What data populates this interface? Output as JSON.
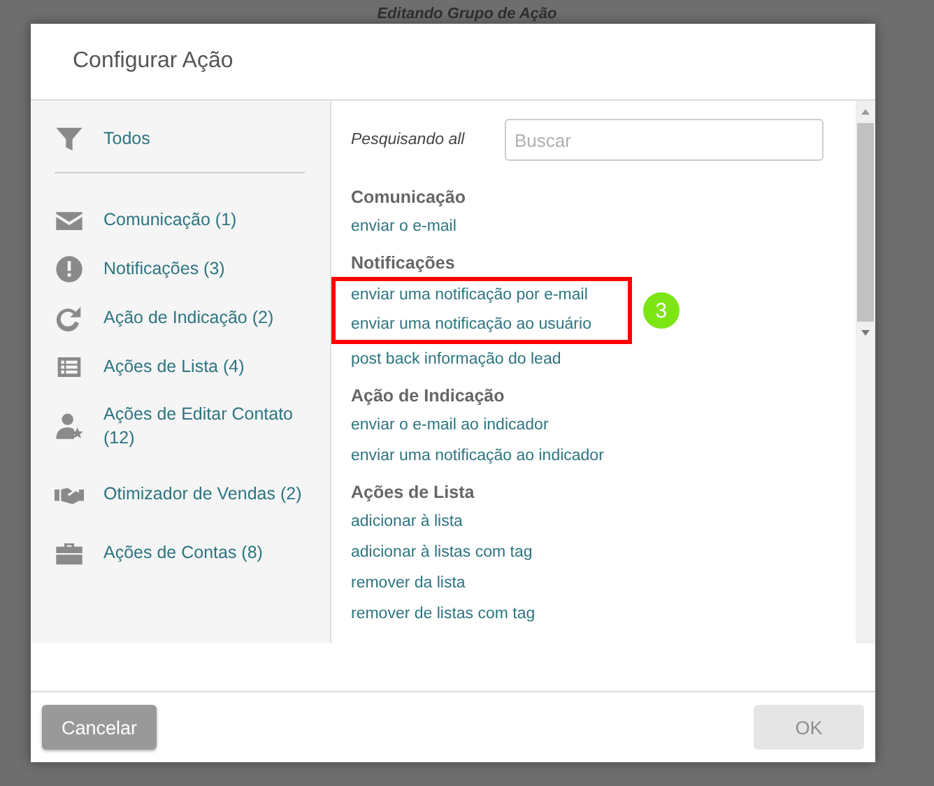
{
  "background_title": "Editando Grupo de Ação",
  "dialog": {
    "title": "Configurar Ação"
  },
  "sidebar": {
    "all_item": {
      "label": "Todos",
      "selected": false
    },
    "items": [
      {
        "label": "Comunicação (1)",
        "selected": false
      },
      {
        "label": "Notificações (3)",
        "selected": false
      },
      {
        "label": "Ação de Indicação (2)",
        "selected": false
      },
      {
        "label": "Ações de Lista (4)",
        "selected": false
      },
      {
        "label": "Ações de Editar Contato (12)",
        "selected": false
      },
      {
        "label": "Otimizador de Vendas (2)",
        "selected": false
      },
      {
        "label": "Ações de Contas (8)",
        "selected": false
      }
    ]
  },
  "search": {
    "label": "Pesquisando all",
    "placeholder": "Buscar"
  },
  "groups": [
    {
      "heading": "Comunicação",
      "items": [
        {
          "label": "enviar o e-mail",
          "highlighted": false
        }
      ]
    },
    {
      "heading": "Notificações",
      "badge": "3",
      "items": [
        {
          "label": "enviar uma notificação por e-mail",
          "highlighted": true
        },
        {
          "label": "enviar uma notificação ao usuário",
          "highlighted": true
        },
        {
          "label": "post back informação do lead",
          "highlighted": false
        }
      ]
    },
    {
      "heading": "Ação de Indicação",
      "items": [
        {
          "label": "enviar o e-mail ao indicador",
          "highlighted": false
        },
        {
          "label": "enviar uma notificação ao indicador",
          "highlighted": false
        }
      ]
    },
    {
      "heading": "Ações de Lista",
      "items": [
        {
          "label": "adicionar à lista",
          "highlighted": false
        },
        {
          "label": "adicionar à listas com tag",
          "highlighted": false
        },
        {
          "label": "remover da lista",
          "highlighted": false
        },
        {
          "label": "remover de listas com tag",
          "highlighted": false
        }
      ]
    }
  ],
  "buttons": [
    {
      "label": "Cancelar",
      "disabled": false
    },
    {
      "label": "OK",
      "disabled": true
    }
  ]
}
